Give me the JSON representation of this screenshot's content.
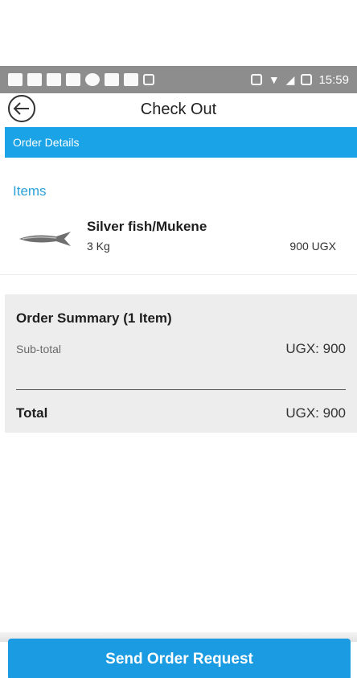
{
  "status_bar": {
    "time": "15:59"
  },
  "header": {
    "title": "Check Out"
  },
  "section": {
    "title": "Order Details"
  },
  "items": {
    "label": "Items",
    "list": [
      {
        "name": "Silver fish/Mukene",
        "quantity": "3 Kg",
        "price": "900 UGX"
      }
    ]
  },
  "summary": {
    "title": "Order Summary (1 Item)",
    "subtotal_label": "Sub-total",
    "subtotal_value": "UGX: 900",
    "total_label": "Total",
    "total_value": "UGX: 900"
  },
  "action": {
    "send_label": "Send Order Request"
  },
  "colors": {
    "accent": "#1aa3e6",
    "items_label": "#2aa1d8",
    "summary_bg": "#ededed"
  }
}
